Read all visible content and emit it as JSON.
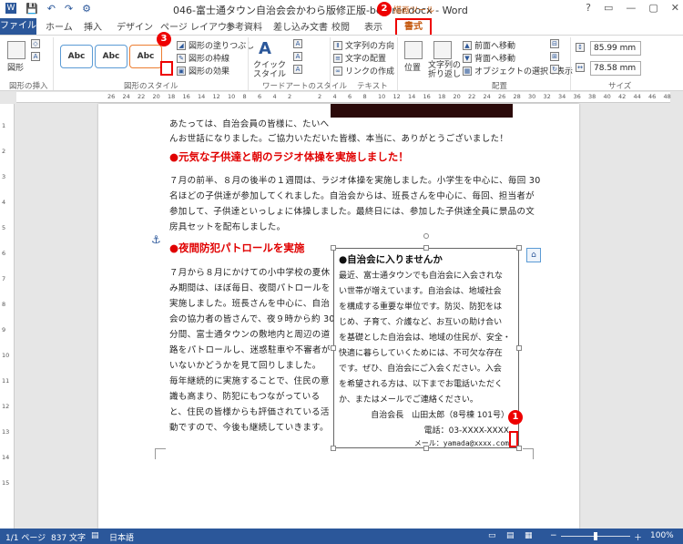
{
  "titlebar": {
    "title": "046-富士通タウン自治会会かわら版修正版-beforer.docx - Word",
    "context_label": "描画ツール",
    "quick_access": [
      "💾",
      "↶",
      "↷",
      "⚙"
    ],
    "win_buttons": [
      "?",
      "▭",
      "—",
      "▢",
      "✕"
    ]
  },
  "tabs": [
    "ファイル",
    "ホーム",
    "挿入",
    "デザイン",
    "ページ レイアウト",
    "参考資料",
    "差し込み文書",
    "校閲",
    "表示",
    "書式"
  ],
  "ribbon": {
    "insert_shape_label": "図形",
    "group_insert_shapes": "図形の挿入",
    "group_shape_styles": "図形のスタイル",
    "group_wordart": "ワードアートのスタイル",
    "group_text": "テキスト",
    "group_arrange": "配置",
    "group_size": "サイズ",
    "style_boxes": [
      "Abc",
      "Abc",
      "Abc"
    ],
    "shape_fill": "図形の塗りつぶし",
    "shape_outline": "図形の枠線",
    "shape_effects": "図形の効果",
    "quick_styles": "クイック\nスタイル",
    "text_direction": "文字列の方向",
    "text_align": "文字の配置",
    "create_link": "リンクの作成",
    "position": "位置",
    "wrap_text": "文字列の\n折り返し",
    "bring_forward": "前面へ移動",
    "send_backward": "背面へ移動",
    "selection_pane": "オブジェクトの選択と表示",
    "height": "85.99 mm",
    "width": "78.58 mm"
  },
  "ruler_numbers": [
    "26",
    "24",
    "22",
    "20",
    "18",
    "16",
    "14",
    "12",
    "10",
    "8",
    "6",
    "4",
    "2",
    "",
    "2",
    "4",
    "6",
    "8",
    "10",
    "12",
    "14",
    "16",
    "18",
    "20",
    "22",
    "24",
    "26",
    "28",
    "30",
    "32",
    "34",
    "36",
    "38",
    "40",
    "42",
    "44",
    "46",
    "48"
  ],
  "vruler_numbers": [
    "1",
    "2",
    "3",
    "4",
    "5",
    "6",
    "7",
    "8",
    "9",
    "10",
    "11",
    "12",
    "13",
    "14",
    "15"
  ],
  "document": {
    "intro_lines": [
      "あたっては、自治会員の皆様に、たいへ",
      "んお世話になりました。ご協力いただいた皆様、本当に、ありがとうございました！"
    ],
    "heading1": "●元気な子供達と朝のラジオ体操を実施しました！",
    "para1": [
      "７月の前半、８月の後半の１週間は、ラジオ体操を実施しました。小学生を中心に、毎回 30",
      "名ほどの子供達が参加してくれました。自治会からは、班長さんを中心に、毎回、担当者が",
      "参加して、子供達といっしょに体操しました。最終日には、参加した子供達全員に景品の文",
      "房具セットを配布しました。"
    ],
    "heading2": "●夜間防犯パトロールを実施",
    "para2": [
      "７月から８月にかけての小中学校の夏休",
      "み期間は、ほぼ毎日、夜間パトロールを",
      "実施しました。班長さんを中心に、自治",
      "会の協力者の皆さんで、夜９時から約 30",
      "分間、富士通タウンの敷地内と周辺の道",
      "路をパトロールし、迷惑駐車や不審者が",
      "いないかどうかを見て回りしました。",
      "毎年継続的に実施することで、住民の意",
      "識も高まり、防犯にもつながっている",
      "と、住民の皆様からも評価されている活",
      "動ですので、今後も継続していきます。"
    ]
  },
  "textbox": {
    "title": "●自治会に入りませんか",
    "lines": [
      "最近、富士通タウンでも自治会に入会されな",
      "い世帯が増えています。自治会は、地域社会",
      "を構成する重要な単位です。防災、防犯をは",
      "じめ、子育て、介護など、お互いの助け合い",
      "を基礎とした自治会は、地域の住民が、安全・",
      "快適に暮らしていくためには、不可欠な存在",
      "です。ぜひ、自治会にご入会ください。入会",
      "を希望される方は、以下までお電話いただく",
      "か、またはメールでご連絡ください。"
    ],
    "sig1": "自治会長　山田太郎（8号棟 101号）",
    "sig2": "電話：03-XXXX-XXXX",
    "sig3": "メール：yamada@xxxx.com"
  },
  "markers": [
    "1",
    "2",
    "3"
  ],
  "status": {
    "page": "1/1 ページ",
    "words": "837 文字",
    "lang": "日本語",
    "zoom": "100%"
  },
  "colors": {
    "accent": "#2b579a",
    "heading": "#e00000",
    "marker": "#ee0000"
  }
}
